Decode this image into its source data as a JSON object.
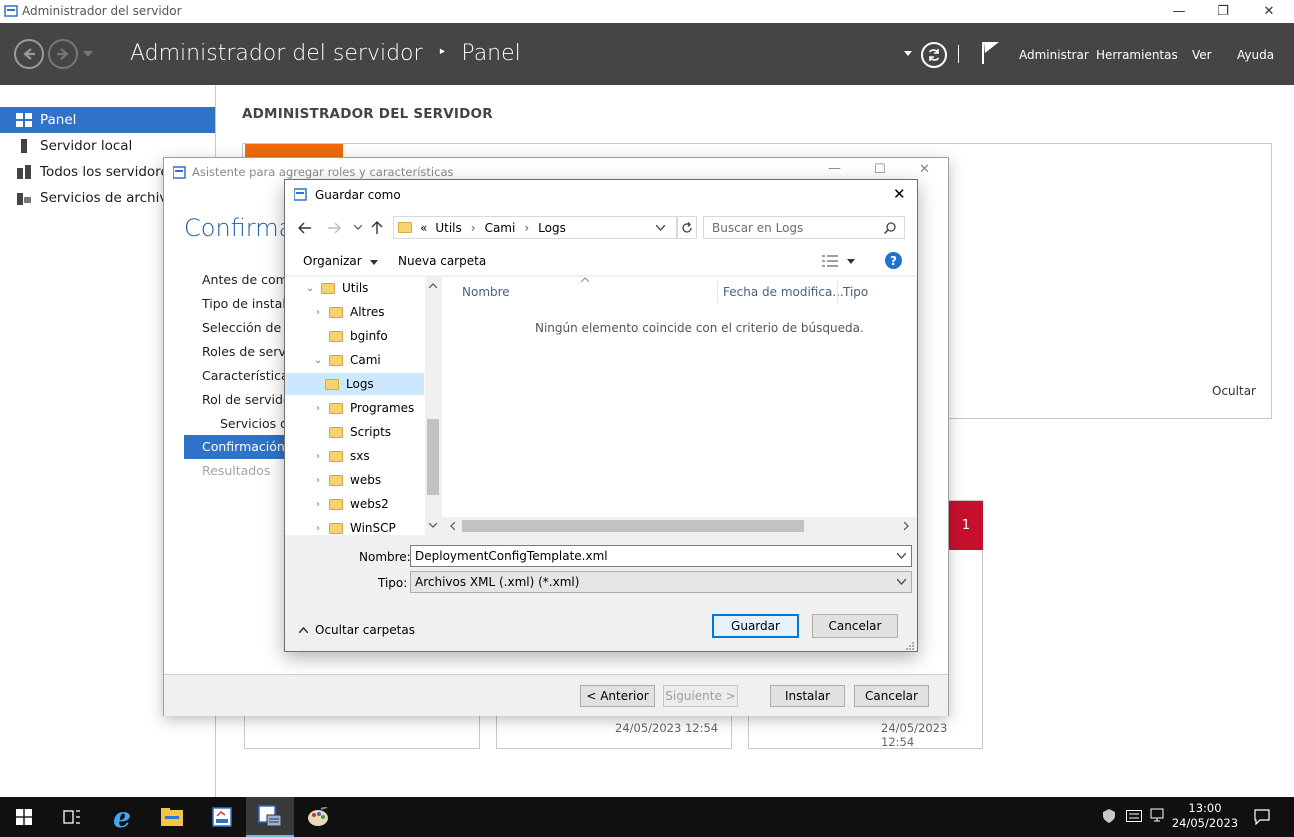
{
  "window": {
    "title": "Administrador del servidor",
    "minimize": "—",
    "restore": "❐",
    "close": "✕"
  },
  "header": {
    "app_name": "Administrador del servidor",
    "separator": "‣",
    "page": "Panel",
    "menus": [
      "Administrar",
      "Herramientas",
      "Ver",
      "Ayuda"
    ]
  },
  "sidebar": {
    "items": [
      {
        "label": "Panel"
      },
      {
        "label": "Servidor local"
      },
      {
        "label": "Todos los servidores"
      },
      {
        "label": "Servicios de archivos"
      }
    ]
  },
  "main": {
    "section_title": "ADMINISTRADOR DEL SERVIDOR",
    "hide_link": "Ocultar",
    "badge_count": "1",
    "timestamps": [
      "24/05/2023 12:54",
      "24/05/2023 12:54"
    ]
  },
  "wizard": {
    "title": "Asistente para agregar roles y características",
    "heading": "Confirmar",
    "steps": [
      {
        "label": "Antes de comenzar"
      },
      {
        "label": "Tipo de instalación"
      },
      {
        "label": "Selección de servidor"
      },
      {
        "label": "Roles de servidor"
      },
      {
        "label": "Características"
      },
      {
        "label": "Rol de servidor web"
      },
      {
        "label": "Servicios de rol"
      },
      {
        "label": "Confirmación"
      },
      {
        "label": "Resultados"
      }
    ],
    "buttons": {
      "previous": "< Anterior",
      "next": "Siguiente >",
      "install": "Instalar",
      "cancel": "Cancelar"
    }
  },
  "saveas": {
    "title": "Guardar como",
    "close": "✕",
    "address": {
      "overflow": "«",
      "parts": [
        "Utils",
        "Cami",
        "Logs"
      ]
    },
    "search_placeholder": "Buscar en Logs",
    "toolbar": {
      "organize": "Organizar",
      "new_folder": "Nueva carpeta"
    },
    "tree": [
      {
        "label": "Utils",
        "chevron": "⌄"
      },
      {
        "label": "Altres",
        "chevron": "›"
      },
      {
        "label": "bginfo",
        "chevron": ""
      },
      {
        "label": "Cami",
        "chevron": "⌄"
      },
      {
        "label": "Logs",
        "chevron": ""
      },
      {
        "label": "Programes",
        "chevron": "›"
      },
      {
        "label": "Scripts",
        "chevron": ""
      },
      {
        "label": "sxs",
        "chevron": "›"
      },
      {
        "label": "webs",
        "chevron": "›"
      },
      {
        "label": "webs2",
        "chevron": "›"
      },
      {
        "label": "WinSCP",
        "chevron": "›"
      }
    ],
    "columns": [
      "Nombre",
      "Fecha de modifica...",
      "Tipo"
    ],
    "empty_message": "Ningún elemento coincide con el criterio de búsqueda.",
    "filename_label": "Nombre:",
    "filename_value": "DeploymentConfigTemplate.xml",
    "type_label": "Tipo:",
    "type_value": "Archivos XML (.xml)  (*.xml)",
    "hide_folders": "Ocultar carpetas",
    "save_button": "Guardar",
    "cancel_button": "Cancelar"
  },
  "taskbar": {
    "time": "13:00",
    "date": "24/05/2023"
  }
}
